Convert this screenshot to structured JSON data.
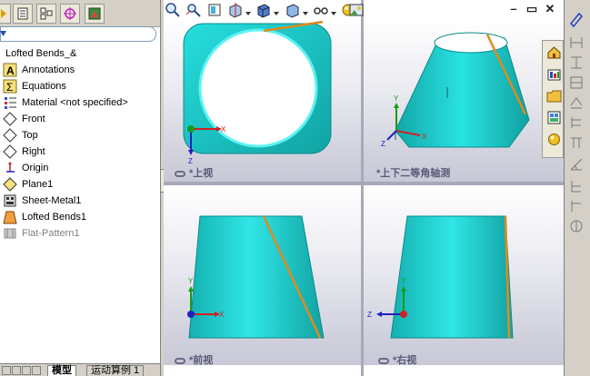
{
  "feature_tree": {
    "root": "Lofted Bends_&",
    "items": [
      {
        "label": "Annotations",
        "icon": "annotations-icon"
      },
      {
        "label": "Equations",
        "icon": "equations-icon"
      },
      {
        "label": "Material <not specified>",
        "icon": "material-icon"
      },
      {
        "label": "Front",
        "icon": "plane-icon"
      },
      {
        "label": "Top",
        "icon": "plane-icon"
      },
      {
        "label": "Right",
        "icon": "plane-icon"
      },
      {
        "label": "Origin",
        "icon": "origin-icon"
      },
      {
        "label": "Plane1",
        "icon": "plane-icon"
      },
      {
        "label": "Sheet-Metal1",
        "icon": "sheet-metal-icon"
      },
      {
        "label": "Lofted Bends1",
        "icon": "lofted-bends-icon"
      },
      {
        "label": "Flat-Pattern1",
        "icon": "flat-pattern-icon"
      }
    ]
  },
  "bottom_tabs": {
    "model": "模型",
    "motion": "运动算例 1"
  },
  "viewports": {
    "top_label": "*上视",
    "iso_label": "*上下二等角轴测",
    "front_label": "*前视",
    "right_label": "*右视"
  },
  "axes": {
    "x": "X",
    "y": "Y",
    "z": "Z"
  },
  "colors": {
    "model": "#22d6d6",
    "model_dark": "#13a9a9",
    "edge": "#e08a1e",
    "panel": "#d4d0c8",
    "viewport_bg": "#e9e9f0"
  }
}
